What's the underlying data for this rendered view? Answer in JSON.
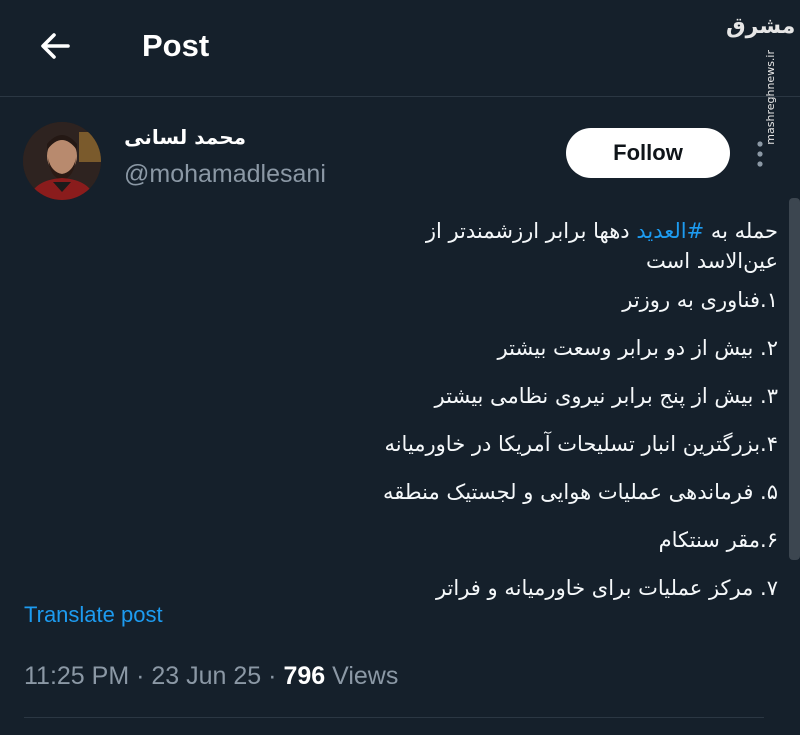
{
  "header": {
    "title": "Post"
  },
  "watermark": {
    "logo": "مشرق",
    "site": "mashreghnews.ir"
  },
  "author": {
    "display_name": "محمد لسانی",
    "handle": "@mohamadlesani"
  },
  "actions": {
    "follow_label": "Follow"
  },
  "tweet": {
    "line1_prefix": "حمله به ",
    "hashtag": "#العدید",
    "line1_suffix": " دهها برابر ارزشمندتر از",
    "line2": "عین‌الاسد است",
    "items": [
      "۱.فناوری به روزتر",
      "۲. بیش از دو برابر وسعت بیشتر",
      "۳. بیش از پنج برابر نیروی نظامی بیشتر",
      "۴.بزرگترین انبار تسلیحات آمریکا در خاورمیانه",
      "۵. فرماندهی عملیات هوایی و لجستیک منطقه",
      "۶.مقر سنتکام",
      "۷. مرکز عملیات برای خاورمیانه و فراتر"
    ]
  },
  "translate_label": "Translate post",
  "meta": {
    "time": "11:25 PM",
    "date": "23 Jun 25",
    "views_count": "796",
    "views_label": "Views",
    "separator": "·"
  }
}
